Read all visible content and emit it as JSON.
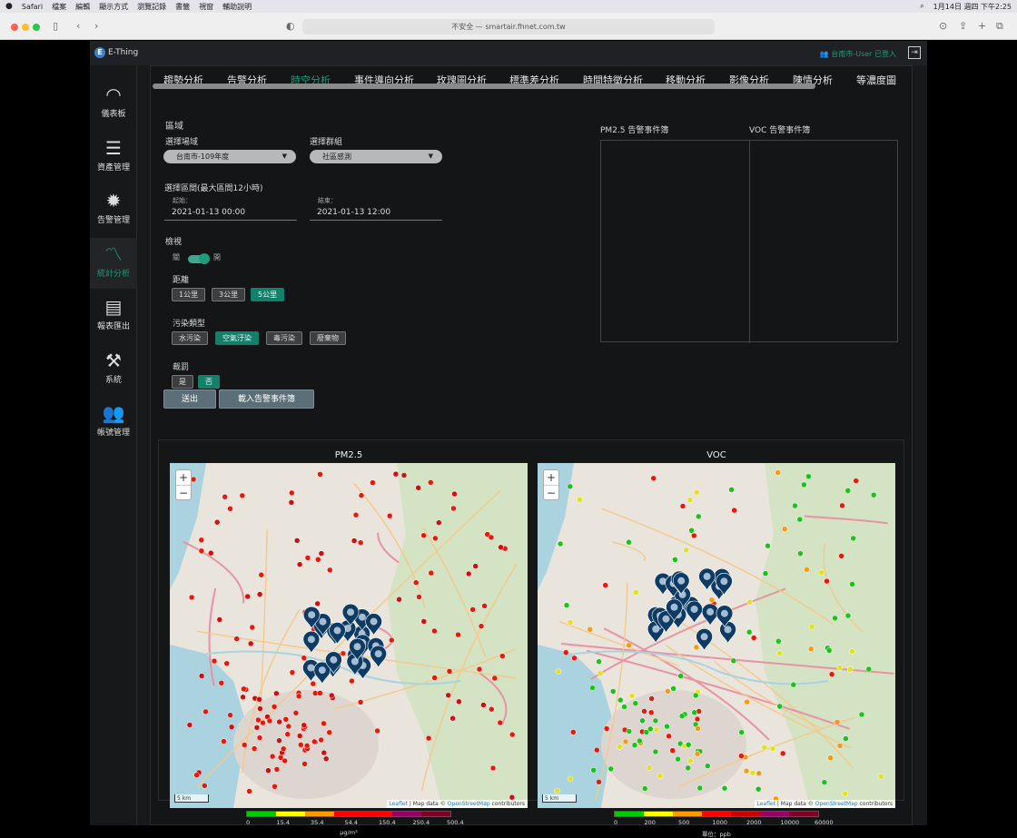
{
  "menubar": {
    "items": [
      "Safari",
      "檔案",
      "編輯",
      "顯示方式",
      "瀏覽記錄",
      "書籤",
      "視窗",
      "輔助說明"
    ],
    "clock": "1月14日 週四 下午2:25"
  },
  "browser": {
    "url_text": "不安全 — smartair.fhnet.com.tw"
  },
  "app": {
    "logo_letter": "E",
    "name": "E-Thing",
    "user_status": "台南市-User 已登入",
    "logout_glyph": "⇥"
  },
  "sidebar": {
    "items": [
      {
        "label": "儀表板",
        "icon": "gauge-icon",
        "glyph": "◠"
      },
      {
        "label": "資產管理",
        "icon": "server-icon",
        "glyph": "☰"
      },
      {
        "label": "告警管理",
        "icon": "alert-gear-icon",
        "glyph": "✹"
      },
      {
        "label": "統計分析",
        "icon": "line-chart-icon",
        "glyph": "〽"
      },
      {
        "label": "報表匯出",
        "icon": "newspaper-icon",
        "glyph": "▤"
      },
      {
        "label": "系統",
        "icon": "tools-icon",
        "glyph": "⚒"
      },
      {
        "label": "帳號管理",
        "icon": "users-icon",
        "glyph": "👥"
      }
    ],
    "active_index": 3
  },
  "tabs": [
    "趨勢分析",
    "告警分析",
    "時空分析",
    "事件導向分析",
    "玫瑰圖分析",
    "標準差分析",
    "時間特徵分析",
    "移動分析",
    "影像分析",
    "陳情分析",
    "等濃度圖"
  ],
  "active_tab_index": 2,
  "form": {
    "region_title": "區域",
    "site_label": "選擇場域",
    "site_value": "台南市-109年度",
    "group_label": "選擇群組",
    "group_value": "社區感測",
    "interval_label": "選擇區間(最大區間12小時)",
    "start_label": "起始：",
    "start_value": "2021-01-13 00:00",
    "end_label": "結束：",
    "end_value": "2021-01-13 12:00",
    "view_label": "檢視",
    "toggle_off": "關",
    "toggle_on": "開",
    "distance_label": "距離",
    "distance_options": [
      "1公里",
      "3公里",
      "5公里"
    ],
    "distance_selected": 2,
    "pollution_label": "污染類型",
    "pollution_options": [
      "水污染",
      "空氣汙染",
      "毒污染",
      "廢棄物"
    ],
    "pollution_selected": 1,
    "penalty_label": "裁罰",
    "penalty_options": [
      "是",
      "否"
    ],
    "penalty_selected": 1,
    "submit_label": "送出",
    "load_label": "載入告警事件簿"
  },
  "events": {
    "pm25_title": "PM2.5 告警事件簿",
    "voc_title": "VOC 告警事件簿"
  },
  "maps": {
    "pm25": {
      "title": "PM2.5",
      "scale": "5 km",
      "attr_leaflet": "Leaflet",
      "attr_text": " | Map data © ",
      "attr_osm": "OpenStreetMap",
      "attr_tail": " contributors",
      "legend_ticks": [
        "0",
        "15.4",
        "35.4",
        "54.4",
        "150.4",
        "250.4",
        "500.4"
      ],
      "legend_colors": [
        "#00cc00",
        "#ffff00",
        "#ff9900",
        "#ff0000",
        "#ff0000",
        "#990066",
        "#7e0023"
      ],
      "unit": "μg/m³"
    },
    "voc": {
      "title": "VOC",
      "scale": "5 km",
      "attr_leaflet": "Leaflet",
      "attr_text": " | Map data © ",
      "attr_osm": "OpenStreetMap",
      "attr_tail": " contributors",
      "legend_ticks": [
        "0",
        "200",
        "500",
        "1000",
        "2000",
        "10000",
        "60000"
      ],
      "legend_colors": [
        "#00cc00",
        "#ffff00",
        "#ff9900",
        "#ff0000",
        "#cc0000",
        "#990066",
        "#7e0023"
      ],
      "unit": "單位：ppb"
    },
    "zoom_in": "+",
    "zoom_out": "−"
  }
}
